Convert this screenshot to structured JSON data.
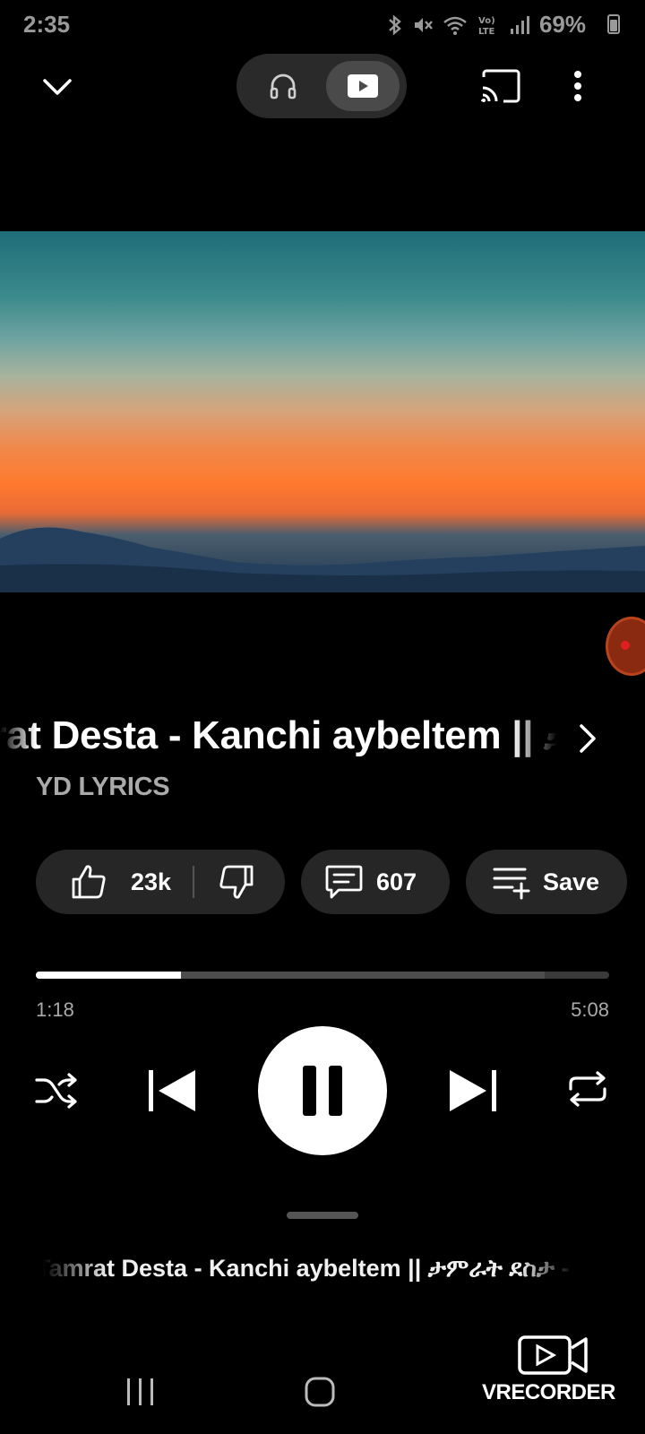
{
  "status_bar": {
    "time": "2:35",
    "battery": "69%",
    "icons": [
      "bluetooth-icon",
      "mute-icon",
      "wifi-icon",
      "volte-icon",
      "signal-icon",
      "battery-icon"
    ]
  },
  "top_bar": {
    "icons": [
      "chevron-down-icon",
      "headphones-icon",
      "video-icon",
      "cast-icon",
      "more-vert-icon"
    ],
    "mode_selected": "video"
  },
  "now_playing": {
    "title": "Tamrat Desta - Kanchi aybeltem || ታምራት ደስታ - ካንቺ አይበልጠም",
    "channel": "YD LYRICS"
  },
  "actions": {
    "likes": "23k",
    "comments": "607",
    "save_label": "Save"
  },
  "playback": {
    "current_time": "1:18",
    "duration": "5:08",
    "progress_fraction": 0.253,
    "buffer_fraction": 0.888,
    "state": "playing"
  },
  "up_next": {
    "title": "Tamrat Desta - Kanchi aybeltem || ታምራት ደስታ - ካንቺ አይበልጠም"
  },
  "watermark": {
    "text": "VRECORDER"
  },
  "colors": {
    "background": "#000000",
    "pill": "#262626",
    "secondary_text": "#aaaaaa"
  }
}
